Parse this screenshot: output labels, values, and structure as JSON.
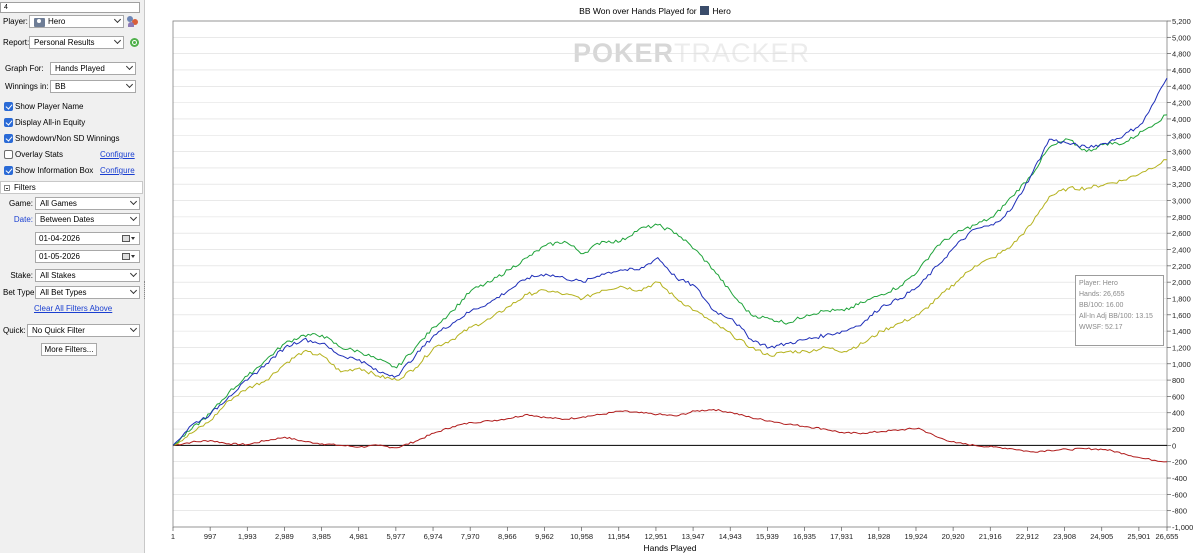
{
  "sidebar": {
    "top_input": "4",
    "player_label": "Player:",
    "player_value": "Hero",
    "report_label": "Report:",
    "report_value": "Personal Results",
    "graph_for_label": "Graph For:",
    "graph_for_value": "Hands Played",
    "winnings_label": "Winnings in:",
    "winnings_value": "BB",
    "checkboxes": [
      {
        "label": "Show Player Name",
        "checked": true
      },
      {
        "label": "Display All-in Equity",
        "checked": true
      },
      {
        "label": "Showdown/Non SD Winnings",
        "checked": true
      },
      {
        "label": "Overlay Stats",
        "checked": false
      },
      {
        "label": "Show Information Box",
        "checked": true
      }
    ],
    "configure_label": "Configure",
    "filters_label": "Filters",
    "game_label": "Game:",
    "game_value": "All Games",
    "date_label": "Date:",
    "date_value": "Between Dates",
    "date_from": "01-04-2026",
    "date_to": "01-05-2026",
    "stake_label": "Stake:",
    "stake_value": "All Stakes",
    "bet_type_label": "Bet Type:",
    "bet_type_value": "All Bet Types",
    "clear_filters": "Clear All Filters Above",
    "quick_label": "Quick:",
    "quick_value": "No Quick Filter",
    "more_filters": "More Filters..."
  },
  "chart_title_prefix": "BB Won over Hands Played for",
  "chart_title_player": "Hero",
  "watermark": {
    "part1": "POKER",
    "part2": "TRACKER"
  },
  "colors": {
    "net": "#1f2fb8",
    "allin": "#1fa33a",
    "showdown": "#b5b21e",
    "nonsd": "#b01c1c",
    "zero": "#000000",
    "grid": "#dcdcdc"
  },
  "info_box": {
    "player": "Player: Hero",
    "hands": "Hands: 26,655",
    "bb100": "BB/100: 16.00",
    "allin_bb100": "All-In Adj BB/100: 13.15",
    "wwsf": "WWSF: 52.17"
  },
  "chart_data": {
    "type": "line",
    "xlabel": "Hands Played",
    "xlim": [
      1,
      26655
    ],
    "ylim": [
      -1000,
      5200
    ],
    "x_ticks": [
      "1",
      "997",
      "1,993",
      "2,989",
      "3,985",
      "4,981",
      "5,977",
      "6,974",
      "7,970",
      "8,966",
      "9,962",
      "10,958",
      "11,954",
      "12,951",
      "13,947",
      "14,943",
      "15,939",
      "16,935",
      "17,931",
      "18,928",
      "19,924",
      "20,920",
      "21,916",
      "22,912",
      "23,908",
      "24,905",
      "25,901",
      "26,655"
    ],
    "y_ticks": [
      "5,200",
      "5,000",
      "4,800",
      "4,600",
      "4,400",
      "4,200",
      "4,000",
      "3,800",
      "3,600",
      "3,400",
      "3,200",
      "3,000",
      "2,800",
      "2,600",
      "2,400",
      "2,200",
      "2,000",
      "1,800",
      "1,600",
      "1,400",
      "1,200",
      "1,000",
      "800",
      "600",
      "400",
      "200",
      "0",
      "-200",
      "-400",
      "-600",
      "-800",
      "-1,000"
    ],
    "x": [
      1,
      500,
      1000,
      1500,
      2000,
      2500,
      3000,
      3500,
      4000,
      4500,
      5000,
      5500,
      6000,
      6500,
      7000,
      7500,
      8000,
      8500,
      9000,
      9500,
      10000,
      10500,
      11000,
      11500,
      12000,
      12500,
      13000,
      13500,
      14000,
      14500,
      15000,
      15500,
      16000,
      16500,
      17000,
      17500,
      18000,
      18500,
      19000,
      19500,
      20000,
      20500,
      21000,
      21500,
      22000,
      22500,
      23000,
      23500,
      24000,
      24500,
      25000,
      25500,
      26000,
      26655
    ],
    "series": [
      {
        "key": "net",
        "values": [
          0,
          250,
          380,
          600,
          800,
          1000,
          1200,
          1300,
          1250,
          1100,
          1050,
          900,
          850,
          1100,
          1350,
          1500,
          1650,
          1750,
          1900,
          2050,
          2100,
          2050,
          2000,
          2100,
          2150,
          2150,
          2300,
          2050,
          1950,
          1650,
          1550,
          1300,
          1200,
          1250,
          1300,
          1350,
          1400,
          1500,
          1700,
          1800,
          1950,
          2200,
          2450,
          2650,
          2700,
          2900,
          3300,
          3750,
          3700,
          3650,
          3700,
          3800,
          3950,
          4500
        ]
      },
      {
        "key": "allin",
        "values": [
          0,
          200,
          390,
          650,
          850,
          1050,
          1250,
          1350,
          1350,
          1200,
          1150,
          1050,
          950,
          1200,
          1450,
          1650,
          1900,
          2000,
          2150,
          2300,
          2450,
          2500,
          2350,
          2500,
          2500,
          2650,
          2700,
          2600,
          2400,
          2150,
          1850,
          1600,
          1550,
          1500,
          1600,
          1650,
          1650,
          1750,
          1850,
          1950,
          2150,
          2450,
          2600,
          2700,
          2800,
          3050,
          3300,
          3650,
          3750,
          3600,
          3700,
          3700,
          3850,
          4050
        ]
      },
      {
        "key": "showdown",
        "values": [
          0,
          150,
          300,
          550,
          700,
          800,
          1000,
          1150,
          1100,
          900,
          950,
          850,
          800,
          950,
          1200,
          1300,
          1450,
          1550,
          1700,
          1850,
          1900,
          1850,
          1800,
          1900,
          1950,
          1900,
          2000,
          1800,
          1650,
          1500,
          1350,
          1200,
          1100,
          1150,
          1150,
          1200,
          1150,
          1250,
          1400,
          1500,
          1600,
          1800,
          2000,
          2200,
          2300,
          2450,
          2700,
          3050,
          3150,
          3150,
          3200,
          3250,
          3350,
          3500
        ]
      },
      {
        "key": "nonsd",
        "values": [
          0,
          40,
          60,
          20,
          10,
          60,
          100,
          50,
          20,
          0,
          -20,
          0,
          -30,
          50,
          150,
          230,
          280,
          300,
          330,
          380,
          340,
          320,
          350,
          380,
          420,
          400,
          380,
          360,
          420,
          440,
          400,
          340,
          300,
          260,
          230,
          200,
          150,
          150,
          170,
          190,
          210,
          100,
          30,
          0,
          -20,
          -40,
          -80,
          -60,
          -50,
          -40,
          -50,
          -100,
          -160,
          -200
        ]
      }
    ]
  }
}
